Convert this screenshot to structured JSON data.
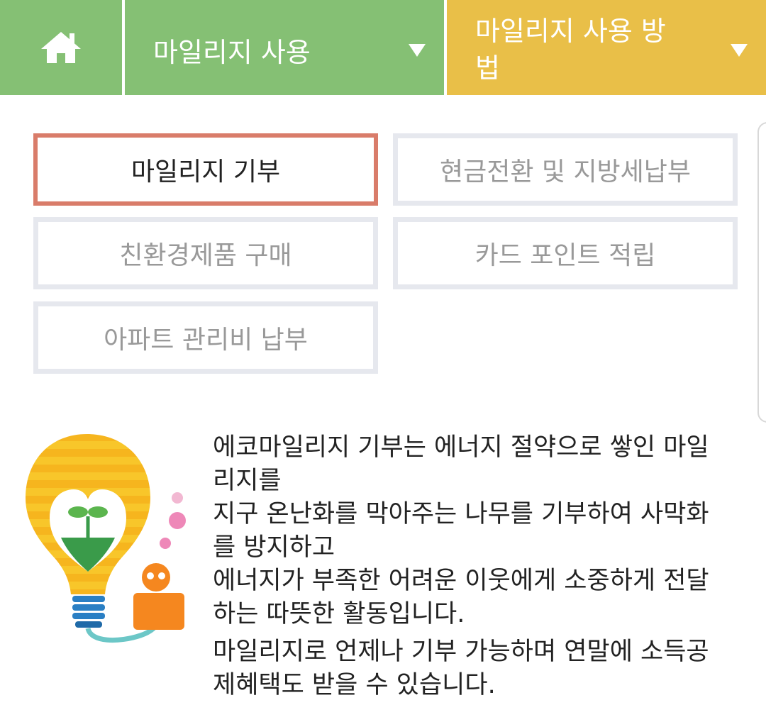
{
  "topbar": {
    "home_icon": "home-icon",
    "menu1_label": "마일리지 사용",
    "menu2_label": "마일리지 사용 방법",
    "caret_icon": "chevron-down-icon",
    "colors": {
      "green": "#85c074",
      "yellow": "#e9bf48"
    }
  },
  "tabs": [
    {
      "label": "마일리지 기부",
      "active": true
    },
    {
      "label": "현금전환 및 지방세납부",
      "active": false
    },
    {
      "label": "친환경제품 구매",
      "active": false
    },
    {
      "label": "카드 포인트 적립",
      "active": false
    },
    {
      "label": "아파트 관리비 납부",
      "active": false
    }
  ],
  "illustration": {
    "icon": "lightbulb-sprout-icon"
  },
  "description": {
    "paragraph1": "에코마일리지 기부는 에너지 절약으로 쌓인 마일\n리지를\n지구 온난화를 막아주는 나무를 기부하여 사막화\n를 방지하고\n에너지가 부족한 어려운 이웃에게 소중하게 전달\n하는 따뜻한 활동입니다.",
    "paragraph2": "마일리지로 언제나 기부 가능하며 연말에 소득공\n제혜택도 받을 수 있습니다."
  }
}
